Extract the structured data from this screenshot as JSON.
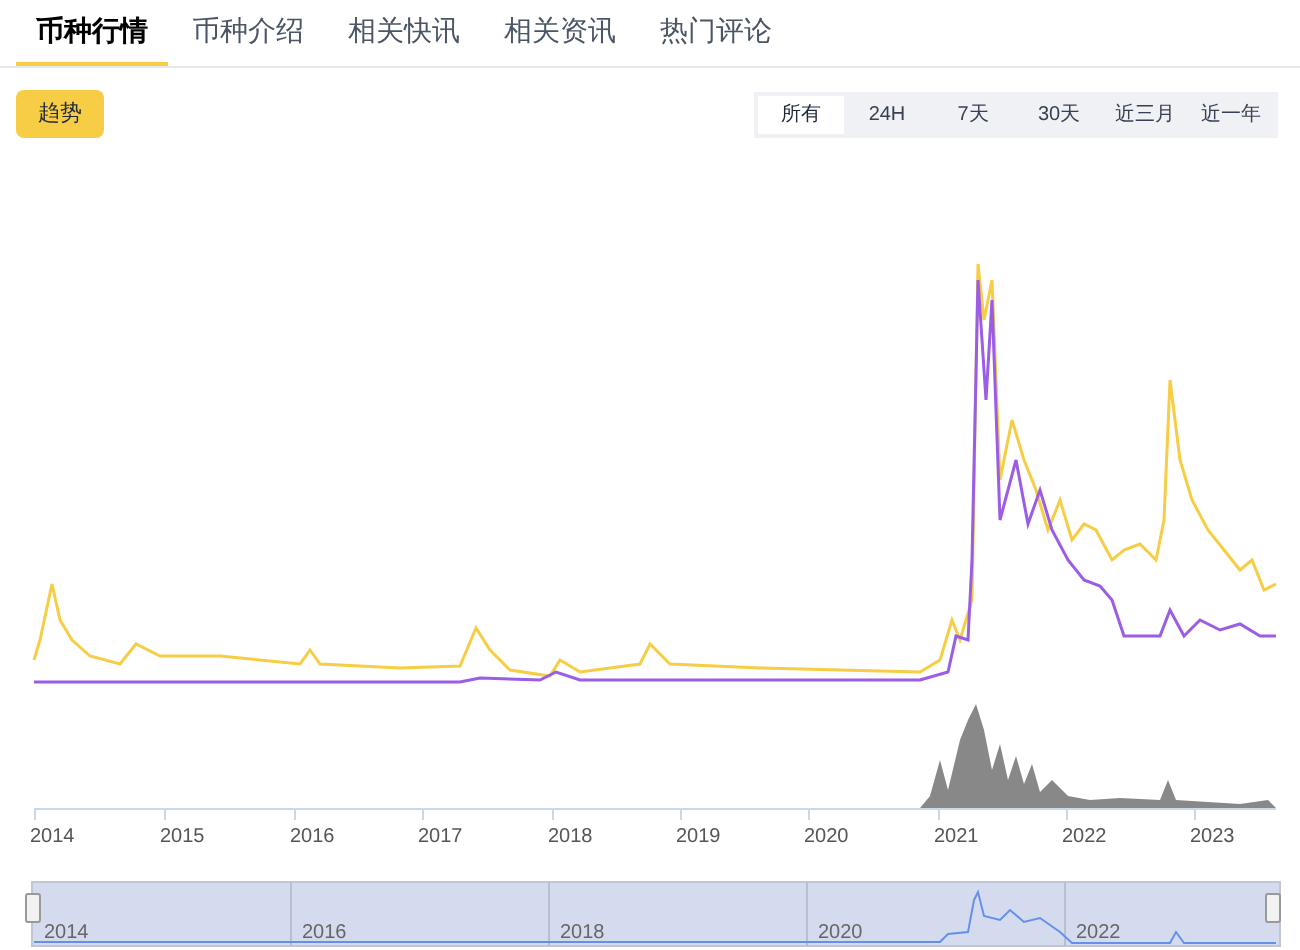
{
  "tabs": [
    {
      "label": "币种行情",
      "selected": true
    },
    {
      "label": "币种介绍",
      "selected": false
    },
    {
      "label": "相关快讯",
      "selected": false
    },
    {
      "label": "相关资讯",
      "selected": false
    },
    {
      "label": "热门评论",
      "selected": false
    }
  ],
  "trend_button": "趋势",
  "ranges": [
    {
      "label": "所有",
      "selected": true
    },
    {
      "label": "24H",
      "selected": false
    },
    {
      "label": "7天",
      "selected": false
    },
    {
      "label": "30天",
      "selected": false
    },
    {
      "label": "近三月",
      "selected": false
    },
    {
      "label": "近一年",
      "selected": false
    }
  ],
  "x_axis_labels": [
    "2014",
    "2015",
    "2016",
    "2017",
    "2018",
    "2019",
    "2020",
    "2021",
    "2022",
    "2023"
  ],
  "navigator_labels": [
    "2014",
    "2016",
    "2018",
    "2020",
    "2022"
  ]
}
